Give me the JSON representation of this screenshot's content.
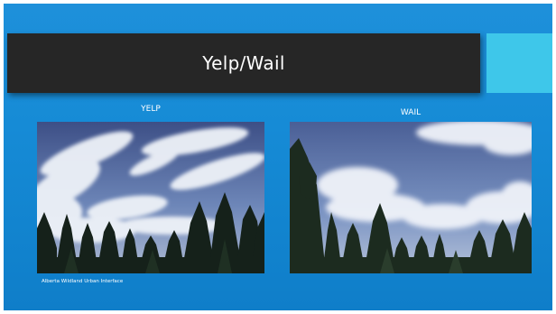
{
  "slide": {
    "title": "Yelp/Wail",
    "left_caption": "YELP",
    "right_caption": "WAIL",
    "credit": "Alberta Wildland Urban Interface",
    "colors": {
      "background": "#1a8bd6",
      "title_bar": "#262626",
      "accent": "#3ec7ea",
      "text": "#ffffff"
    }
  },
  "images": [
    {
      "name": "yelp-video-frame",
      "depicts": "sky-clouds-pine-trees"
    },
    {
      "name": "wail-video-frame",
      "depicts": "sky-clouds-pine-trees"
    }
  ]
}
